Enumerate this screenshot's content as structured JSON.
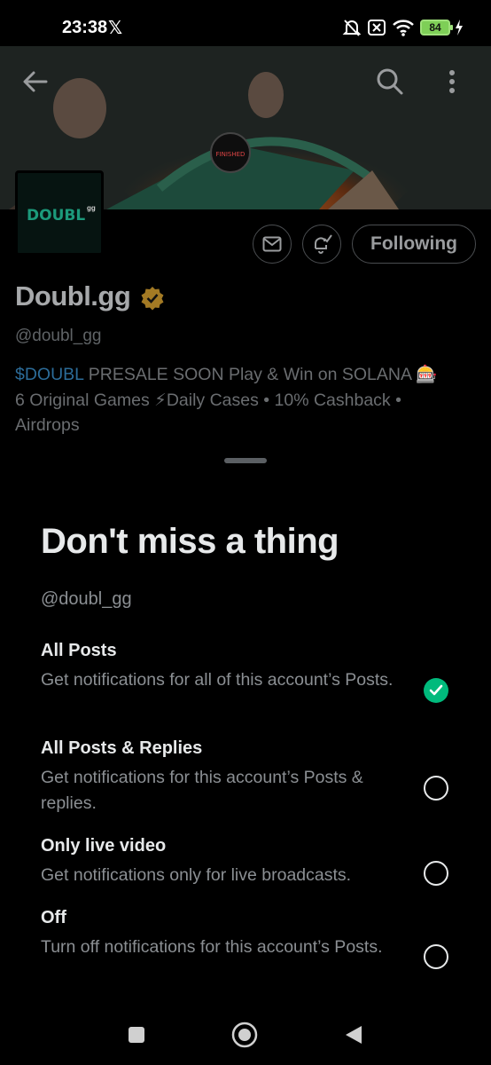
{
  "status_bar": {
    "time": "23:38",
    "battery": "84",
    "icons": [
      "x-logo-icon",
      "bell-muted-icon",
      "sim-off-icon",
      "wifi-icon",
      "battery-icon",
      "charging-icon"
    ]
  },
  "profile": {
    "banner_badge": "FINISHED",
    "avatar_text": "DOUBL",
    "avatar_sub": "gg",
    "following_label": "Following",
    "display_name": "Doubl.gg",
    "handle": "@doubl_gg",
    "bio_cashtag": "$DOUBL",
    "bio_rest": " PRESALE SOON  Play & Win on SOLANA 🎰",
    "bio_line2": "6 Original Games  ⚡Daily Cases • 10% Cashback •",
    "bio_line3": "Airdrops"
  },
  "sheet": {
    "title": "Don't miss a thing",
    "handle": "@doubl_gg",
    "options": [
      {
        "title": "All Posts",
        "desc": "Get notifications for all of this account’s Posts.",
        "selected": true
      },
      {
        "title": "All Posts & Replies",
        "desc": "Get notifications for this account’s Posts & replies.",
        "selected": false
      },
      {
        "title": "Only live video",
        "desc": "Get notifications only for live broadcasts.",
        "selected": false
      },
      {
        "title": "Off",
        "desc": "Turn off notifications for this account’s Posts.",
        "selected": false
      }
    ]
  },
  "colors": {
    "accent_green": "#00ba7c",
    "verified_gold": "#c99a2e",
    "cashtag_blue": "#2c6c99"
  }
}
